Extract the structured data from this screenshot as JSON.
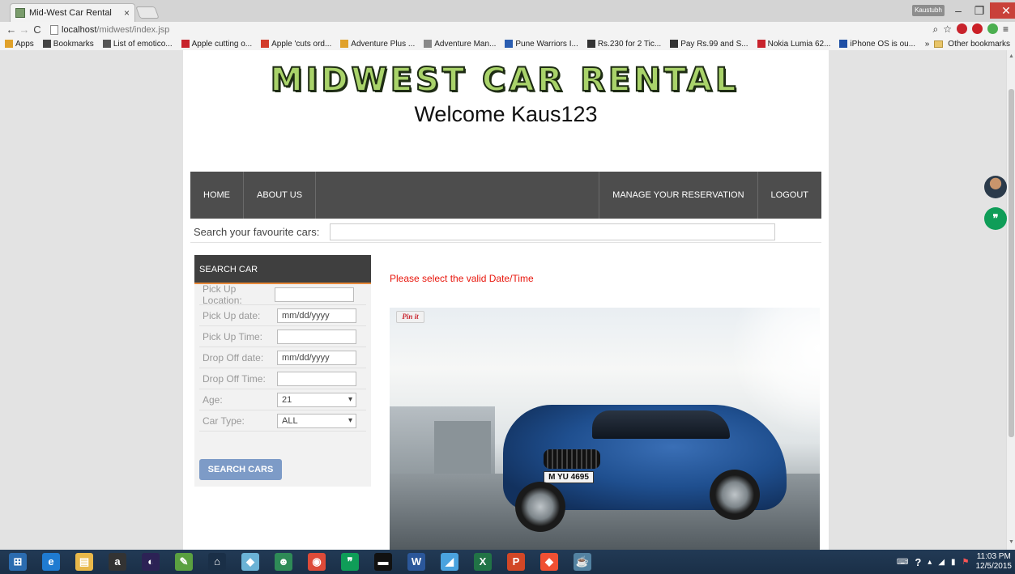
{
  "browser": {
    "tab_title": "Mid-West Car Rental",
    "tab_close": "×",
    "user_label": "Kaustubh",
    "url_host": "localhost",
    "url_path": "/midwest/index.jsp",
    "bookmarks": [
      {
        "label": "Apps",
        "color": "#e0a12a"
      },
      {
        "label": "Bookmarks",
        "color": "#444444"
      },
      {
        "label": "List of emotico...",
        "color": "#555555"
      },
      {
        "label": "Apple cutting o...",
        "color": "#c8232c"
      },
      {
        "label": "Apple 'cuts ord...",
        "color": "#d23c2a"
      },
      {
        "label": "Adventure Plus ...",
        "color": "#e0a12a"
      },
      {
        "label": "Adventure Man...",
        "color": "#888888"
      },
      {
        "label": "Pune Warriors I...",
        "color": "#2a5db0"
      },
      {
        "label": "Rs.230 for 2 Tic...",
        "color": "#333333"
      },
      {
        "label": "Pay Rs.99 and S...",
        "color": "#333333"
      },
      {
        "label": "Nokia Lumia 62...",
        "color": "#c8232c"
      },
      {
        "label": "iPhone OS is ou...",
        "color": "#1e4fa5"
      }
    ],
    "other_bookmarks": "Other bookmarks",
    "more_bookmarks": "»"
  },
  "site": {
    "logo_text": "MIDWEST CAR RENTAL",
    "welcome": "Welcome Kaus123",
    "nav": {
      "home": "HOME",
      "about": "ABOUT US",
      "manage": "MANAGE YOUR RESERVATION",
      "logout": "LOGOUT"
    },
    "search_label": "Search your favourite cars:",
    "search_placeholder": "",
    "sidebar": {
      "title": "SEARCH CAR",
      "fields": [
        {
          "label": "Pick Up Location:",
          "value": ""
        },
        {
          "label": "Pick Up date:",
          "value": "mm/dd/yyyy"
        },
        {
          "label": "Pick Up Time:",
          "value": ""
        },
        {
          "label": "Drop Off date:",
          "value": "mm/dd/yyyy"
        },
        {
          "label": "Drop Off Time:",
          "value": ""
        },
        {
          "label": "Age:",
          "value": "21"
        },
        {
          "label": "Car Type:",
          "value": "ALL"
        }
      ],
      "button": "SEARCH CARS"
    },
    "error": "Please select the valid Date/Time",
    "pin_label": "Pin it",
    "plate": "M YU 4695"
  },
  "taskbar": {
    "time": "11:03 PM",
    "date": "12/5/2015",
    "apps": [
      {
        "name": "start",
        "glyph": "⊞",
        "color": "#2b6cb0"
      },
      {
        "name": "ie",
        "glyph": "e",
        "color": "#1f7bd1"
      },
      {
        "name": "explorer",
        "glyph": "▤",
        "color": "#e8b84a"
      },
      {
        "name": "amazon",
        "glyph": "a",
        "color": "#333333"
      },
      {
        "name": "eclipse",
        "glyph": "◐",
        "color": "#2c2255"
      },
      {
        "name": "paint",
        "glyph": "✎",
        "color": "#5aa040"
      },
      {
        "name": "home",
        "glyph": "⌂",
        "color": "#1a2f47"
      },
      {
        "name": "folder",
        "glyph": "◆",
        "color": "#6bb3d6"
      },
      {
        "name": "people",
        "glyph": "☻",
        "color": "#2e8b57"
      },
      {
        "name": "chrome",
        "glyph": "◉",
        "color": "#dd4b39"
      },
      {
        "name": "hangouts",
        "glyph": "❞",
        "color": "#0f9d58"
      },
      {
        "name": "cmd",
        "glyph": "▬",
        "color": "#111111"
      },
      {
        "name": "word",
        "glyph": "W",
        "color": "#2b579a"
      },
      {
        "name": "app",
        "glyph": "◢",
        "color": "#4aa3df"
      },
      {
        "name": "excel",
        "glyph": "X",
        "color": "#217346"
      },
      {
        "name": "powerpoint",
        "glyph": "P",
        "color": "#d24726"
      },
      {
        "name": "git",
        "glyph": "◆",
        "color": "#f05033"
      },
      {
        "name": "java",
        "glyph": "☕",
        "color": "#5382a1"
      }
    ]
  }
}
